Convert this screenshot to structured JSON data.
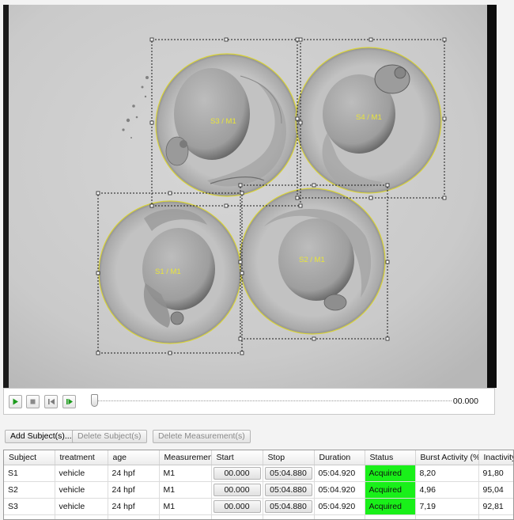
{
  "subjects": [
    {
      "label": "S3 / M1"
    },
    {
      "label": "S4 / M1"
    },
    {
      "label": "S1 / M1"
    },
    {
      "label": "S2 / M1"
    }
  ],
  "playback": {
    "play_icon": "play-icon",
    "stop_icon": "stop-icon",
    "step_back_icon": "step-back-icon",
    "step_forward_icon": "step-forward-icon",
    "time": "00.000",
    "position_fraction": 0
  },
  "actions": {
    "add_subjects": "Add Subject(s)...",
    "delete_subjects": "Delete Subject(s)",
    "delete_measurements": "Delete Measurement(s)"
  },
  "table": {
    "headers": [
      "Subject",
      "treatment",
      "age",
      "Measurement",
      "Start",
      "Stop",
      "Duration",
      "Status",
      "Burst Activity (%)",
      "Inactivity"
    ],
    "rows": [
      {
        "subject": "S1",
        "treatment": "vehicle",
        "age": "24 hpf",
        "measurement": "M1",
        "start": "00.000",
        "stop": "05:04.880",
        "duration": "05:04.920",
        "status": "Acquired",
        "burst": "8,20",
        "inactivity": "91,80"
      },
      {
        "subject": "S2",
        "treatment": "vehicle",
        "age": "24 hpf",
        "measurement": "M1",
        "start": "00.000",
        "stop": "05:04.880",
        "duration": "05:04.920",
        "status": "Acquired",
        "burst": "4,96",
        "inactivity": "95,04"
      },
      {
        "subject": "S3",
        "treatment": "vehicle",
        "age": "24 hpf",
        "measurement": "M1",
        "start": "00.000",
        "stop": "05:04.880",
        "duration": "05:04.920",
        "status": "Acquired",
        "burst": "7,19",
        "inactivity": "92,81"
      }
    ]
  },
  "colors": {
    "status_acquired": "#19f019",
    "roi_circle": "#d8d23a",
    "label": "#e8e43a"
  }
}
